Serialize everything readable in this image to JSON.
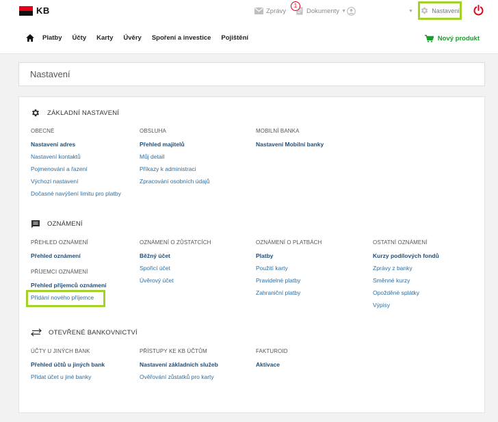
{
  "brand": {
    "name": "KB",
    "colors": {
      "red": "#e2001a",
      "black": "#111111",
      "link": "#2c6ea3",
      "highlight": "#a2d22a",
      "green": "#1a9e2a"
    }
  },
  "top": {
    "messages_label": "Zprávy",
    "documents_label": "Dokumenty",
    "documents_badge": "1",
    "settings_label": "Nastavení"
  },
  "nav": {
    "items": [
      "Platby",
      "Účty",
      "Karty",
      "Úvěry",
      "Spoření a investice",
      "Pojištění"
    ],
    "new_product": "Nový produkt"
  },
  "page": {
    "title": "Nastavení"
  },
  "sections": {
    "basic": {
      "title": "ZÁKLADNÍ NASTAVENÍ",
      "cols": [
        {
          "head": "OBECNÉ",
          "links": [
            "Nastavení adres",
            "Nastavení kontaktů",
            "Pojmenování a řazení",
            "Výchozí nastavení",
            "Dočasné navýšení limitu pro platby"
          ]
        },
        {
          "head": "OBSLUHA",
          "links": [
            "Přehled majitelů",
            "Můj detail",
            "Příkazy k administraci",
            "Zpracování osobních údajů"
          ]
        },
        {
          "head": "MOBILNÍ BANKA",
          "links": [
            "Nastavení Mobilní banky"
          ]
        }
      ]
    },
    "notifications": {
      "title": "OZNÁMENÍ",
      "cols": [
        {
          "head": "PŘEHLED OZNÁMENÍ",
          "links": [
            "Přehled oznámení"
          ],
          "head2": "PŘÍJEMCI OZNÁMENÍ",
          "links2": [
            "Přehled příjemců oznámení",
            "Přidání nového příjemce"
          ]
        },
        {
          "head": "OZNÁMENÍ O ZŮSTATCÍCH",
          "links": [
            "Běžný účet",
            "Spořicí účet",
            "Úvěrový účet"
          ]
        },
        {
          "head": "OZNÁMENÍ O PLATBÁCH",
          "links": [
            "Platby",
            "Použití karty",
            "Pravidelné platby",
            "Zahraniční platby"
          ]
        },
        {
          "head": "OSTATNÍ OZNÁMENÍ",
          "links": [
            "Kurzy podílových fondů",
            "Zprávy z banky",
            "Směnné kurzy",
            "Opožděné splátky",
            "Výpisy"
          ]
        }
      ]
    },
    "openbanking": {
      "title": "OTEVŘENÉ BANKOVNICTVÍ",
      "cols": [
        {
          "head": "ÚČTY U JINÝCH BANK",
          "links": [
            "Přehled účtů u jiných bank",
            "Přidat účet u jiné banky"
          ]
        },
        {
          "head": "PŘÍSTUPY KE KB ÚČTŮM",
          "links": [
            "Nastavení základních služeb",
            "Ověřování zůstatků pro karty"
          ]
        },
        {
          "head": "FAKTUROID",
          "links": [
            "Aktivace"
          ]
        }
      ]
    }
  }
}
